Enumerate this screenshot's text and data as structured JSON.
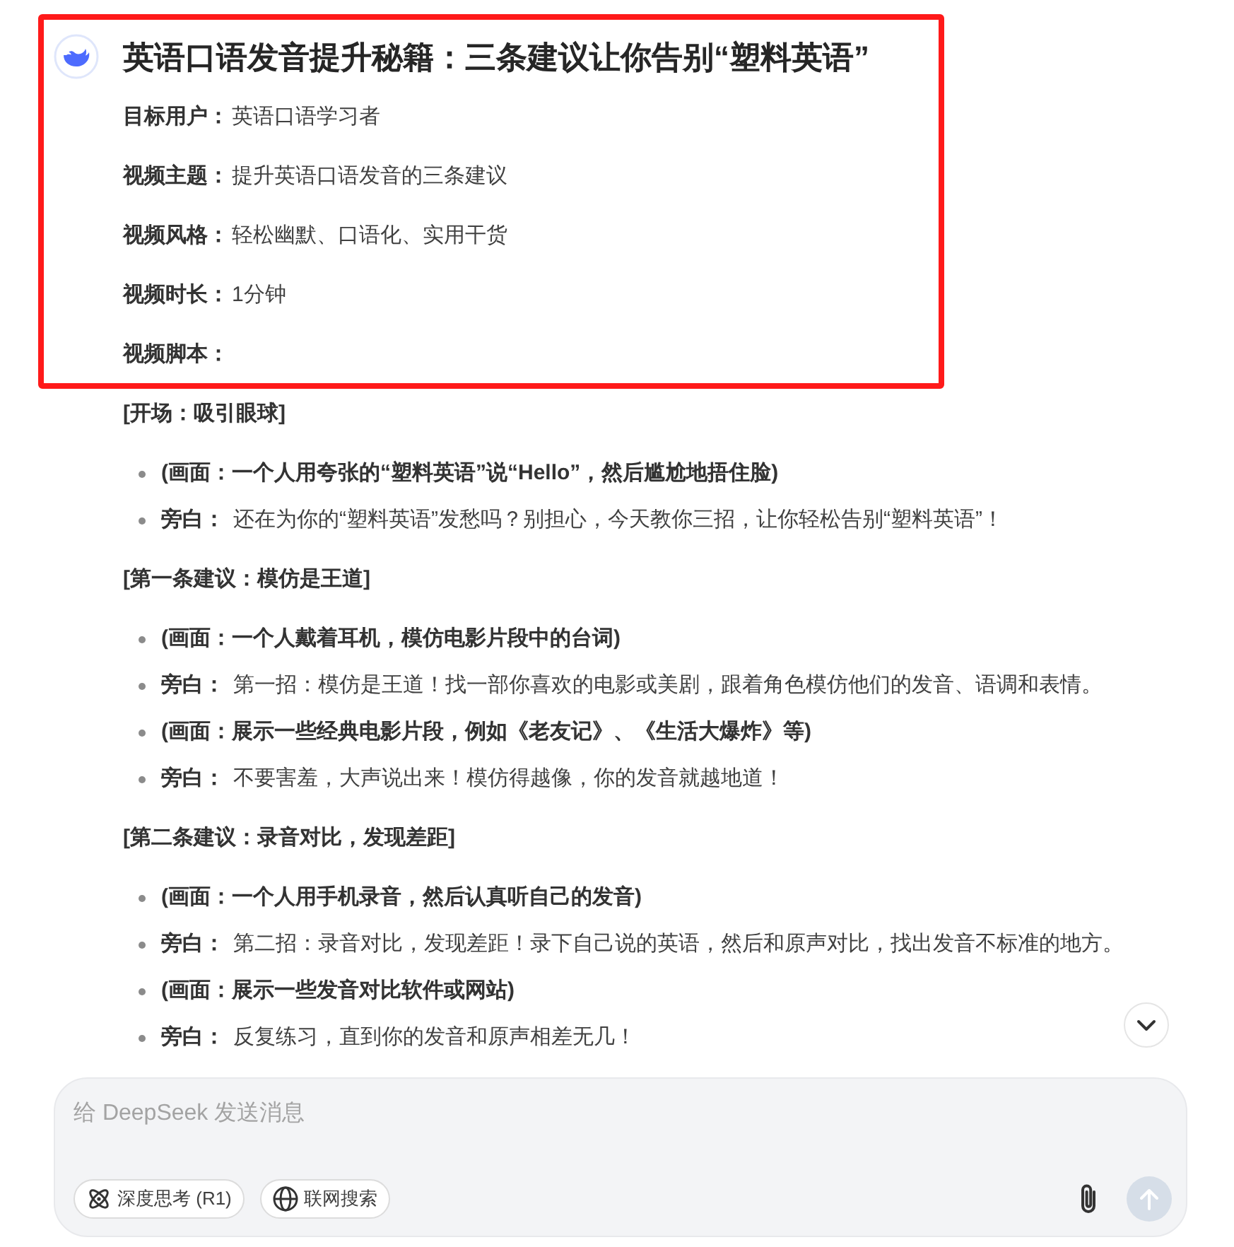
{
  "title": "英语口语发音提升秘籍：三条建议让你告别“塑料英语”",
  "fields": [
    {
      "label": "目标用户：",
      "value": "英语口语学习者"
    },
    {
      "label": "视频主题：",
      "value": "提升英语口语发音的三条建议"
    },
    {
      "label": "视频风格：",
      "value": "轻松幽默、口语化、实用干货"
    },
    {
      "label": "视频时长：",
      "value": "1分钟"
    },
    {
      "label": "视频脚本："
    }
  ],
  "sections": [
    {
      "heading": "[开场：吸引眼球]",
      "items": [
        {
          "kind": "scene",
          "text": "(画面：一个人用夸张的“塑料英语”说“Hello”，然后尴尬地捂住脸)"
        },
        {
          "kind": "narration",
          "label": "旁白：",
          "text": "还在为你的“塑料英语”发愁吗？别担心，今天教你三招，让你轻松告别“塑料英语”！"
        }
      ]
    },
    {
      "heading": "[第一条建议：模仿是王道]",
      "items": [
        {
          "kind": "scene",
          "text": "(画面：一个人戴着耳机，模仿电影片段中的台词)"
        },
        {
          "kind": "narration",
          "label": "旁白：",
          "text": "第一招：模仿是王道！找一部你喜欢的电影或美剧，跟着角色模仿他们的发音、语调和表情。"
        },
        {
          "kind": "scene",
          "text": "(画面：展示一些经典电影片段，例如《老友记》、《生活大爆炸》等)"
        },
        {
          "kind": "narration",
          "label": "旁白：",
          "text": "不要害羞，大声说出来！模仿得越像，你的发音就越地道！"
        }
      ]
    },
    {
      "heading": "[第二条建议：录音对比，发现差距]",
      "items": [
        {
          "kind": "scene",
          "text": "(画面：一个人用手机录音，然后认真听自己的发音)"
        },
        {
          "kind": "narration",
          "label": "旁白：",
          "text": "第二招：录音对比，发现差距！录下自己说的英语，然后和原声对比，找出发音不标准的地方。"
        },
        {
          "kind": "scene",
          "text": "(画面：展示一些发音对比软件或网站)"
        },
        {
          "kind": "narration",
          "label": "旁白：",
          "text": "反复练习，直到你的发音和原声相差无几！"
        }
      ]
    }
  ],
  "composer": {
    "placeholder": "给 DeepSeek 发送消息",
    "toggles": [
      {
        "kind": "think",
        "label": "深度思考 (R1)",
        "on": false
      },
      {
        "kind": "web",
        "label": "联网搜索",
        "on": false
      }
    ],
    "send_disabled": true
  }
}
